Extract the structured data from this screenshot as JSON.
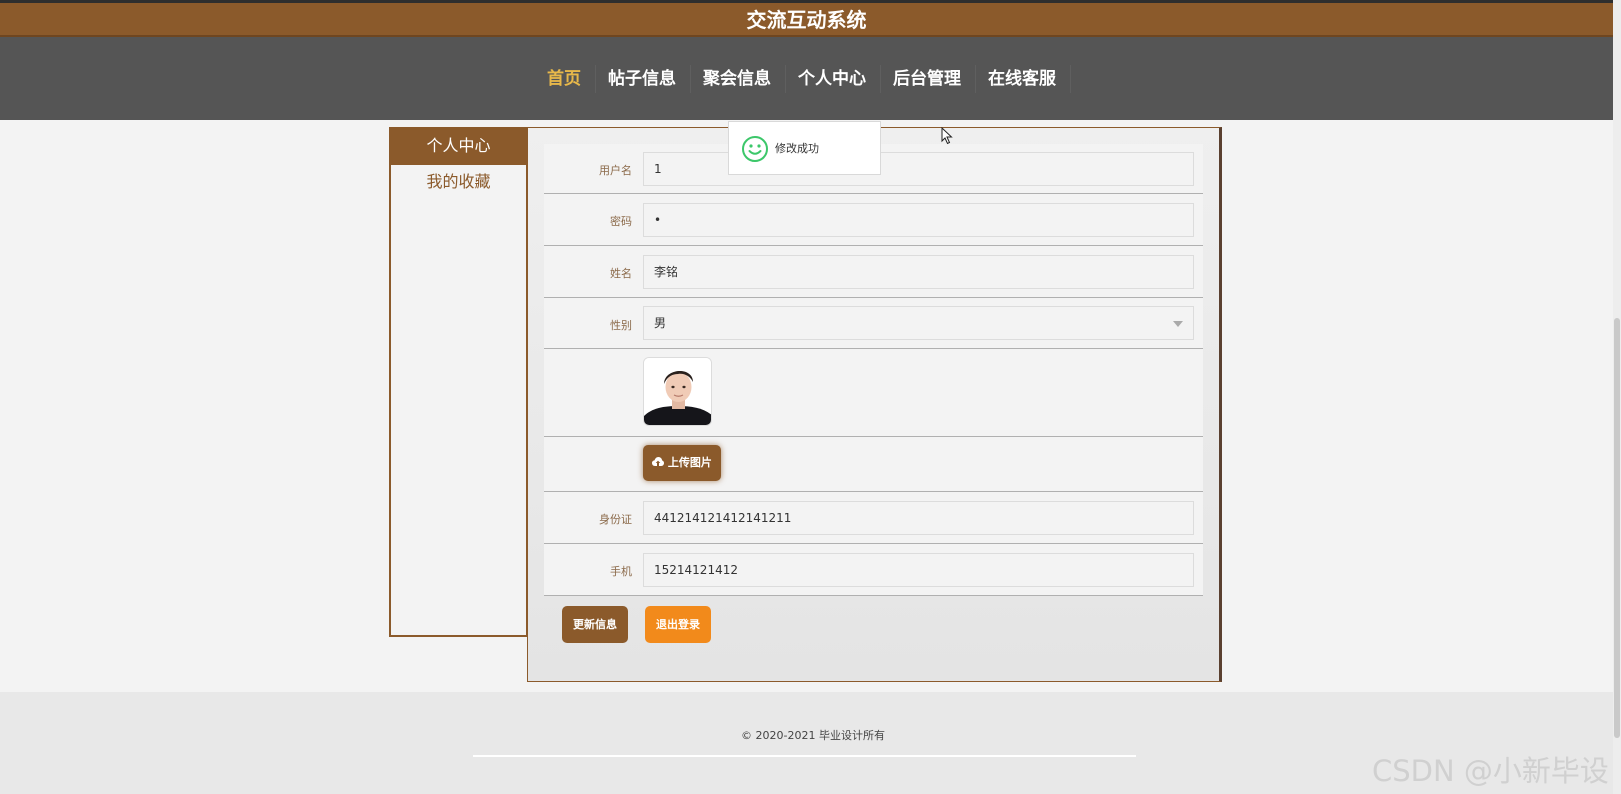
{
  "app": {
    "title": "交流互动系统"
  },
  "nav": {
    "items": [
      "首页",
      "帖子信息",
      "聚会信息",
      "个人中心",
      "后台管理",
      "在线客服"
    ],
    "active": "首页"
  },
  "sidebar": {
    "items": [
      "个人中心",
      "我的收藏"
    ],
    "active": "个人中心"
  },
  "form": {
    "username": {
      "label": "用户名",
      "value": "1"
    },
    "password": {
      "label": "密码",
      "value": "•"
    },
    "name": {
      "label": "姓名",
      "value": "李铭"
    },
    "gender": {
      "label": "性别",
      "value": "男"
    },
    "upload_label": "上传图片",
    "id_card": {
      "label": "身份证",
      "value": "441214121412141211"
    },
    "phone": {
      "label": "手机",
      "value": "15214121412"
    }
  },
  "actions": {
    "update_label": "更新信息",
    "logout_label": "退出登录"
  },
  "toast": {
    "message": "修改成功",
    "icon": "smile-icon"
  },
  "footer": {
    "copyright": "© 2020-2021 毕业设计所有"
  },
  "watermark": "CSDN @小新毕设",
  "colors": {
    "brand": "#8b5a2b",
    "nav_bg": "#555555",
    "active_nav": "#e8b84a",
    "logout": "#f28a1b",
    "toast_icon": "#3cc76a"
  }
}
